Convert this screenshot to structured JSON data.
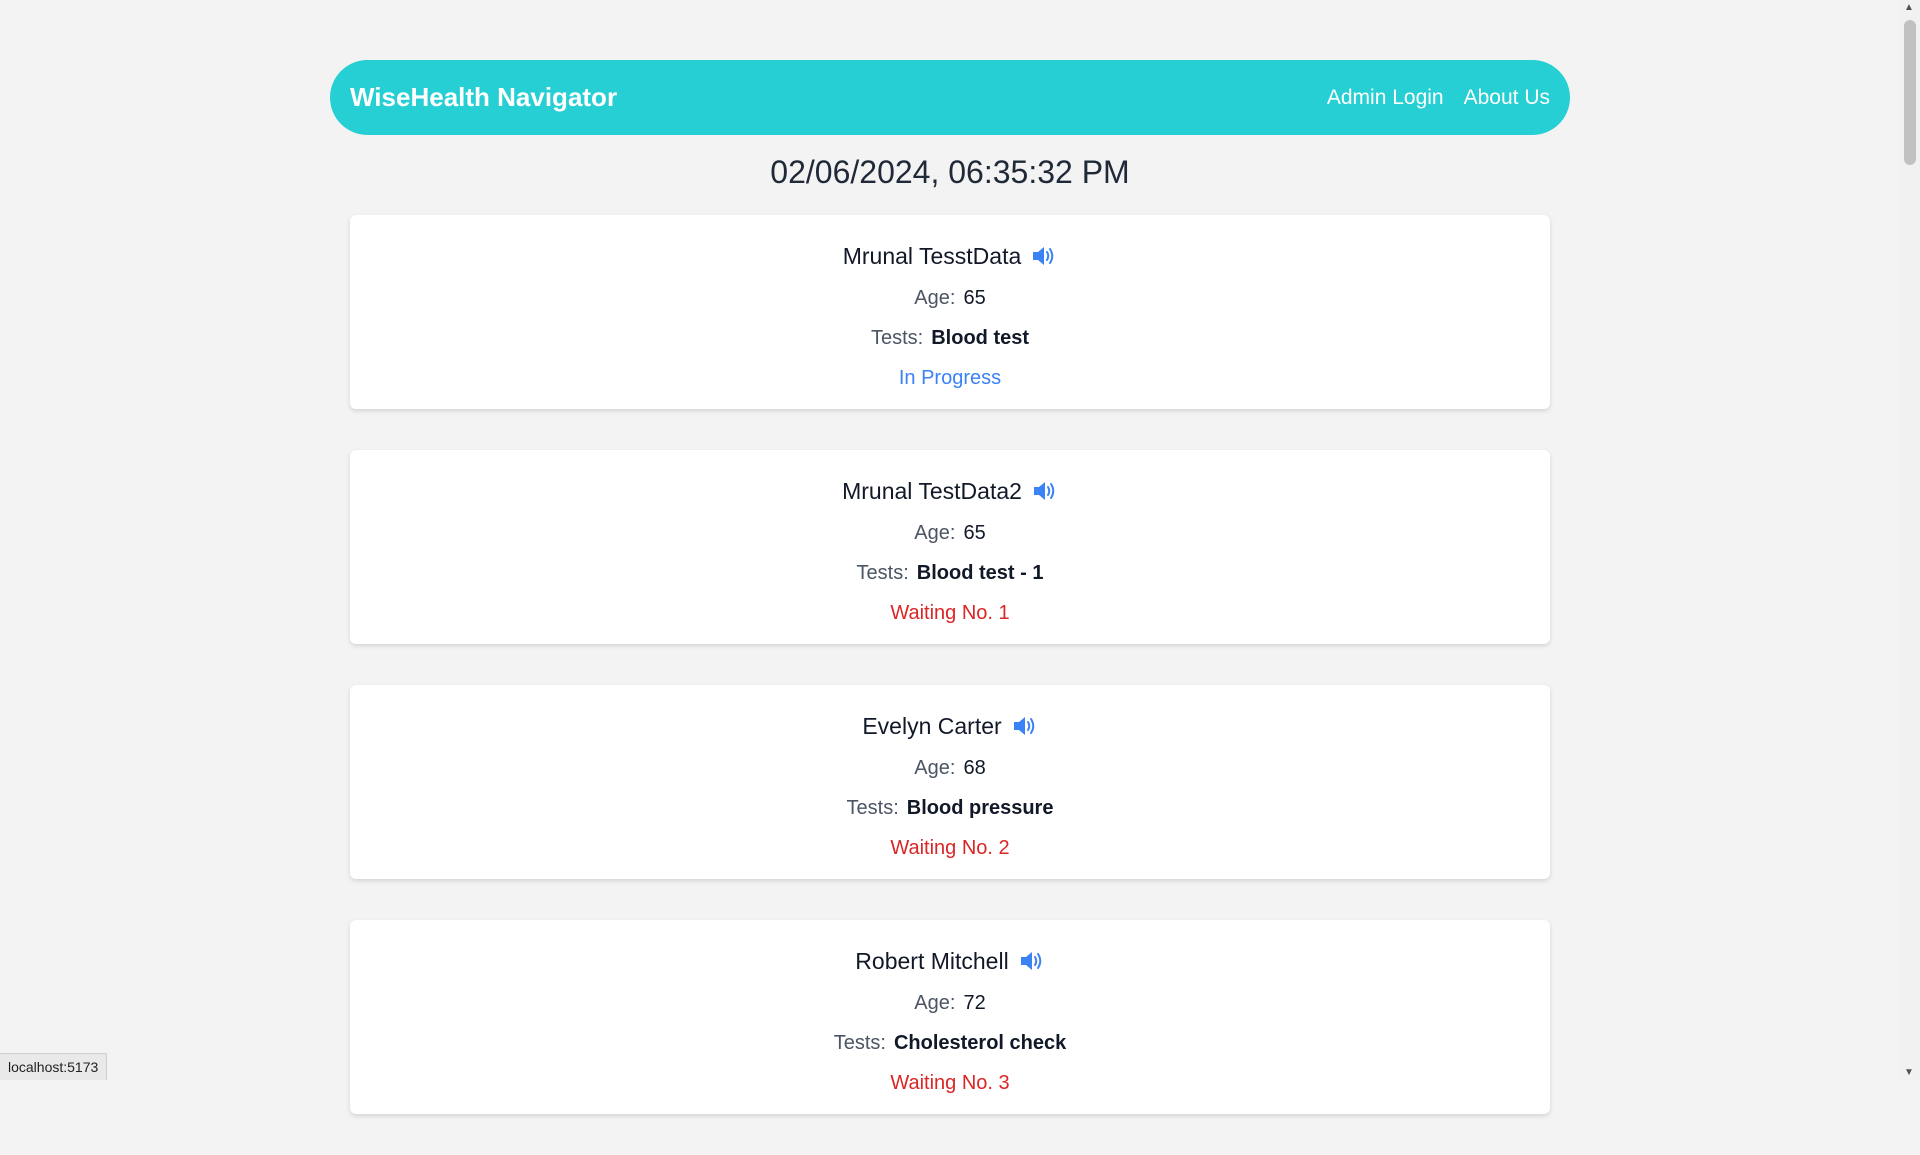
{
  "navbar": {
    "brand": "WiseHealth Navigator",
    "links": [
      "Admin Login",
      "About Us"
    ],
    "color": "#26cfd3"
  },
  "datetime": "02/06/2024, 06:35:32 PM",
  "labels": {
    "age": "Age:",
    "tests": "Tests:"
  },
  "patients": [
    {
      "name": "Mrunal TesstData",
      "age": "65",
      "tests": "Blood test",
      "status": "In Progress",
      "status_type": "progress"
    },
    {
      "name": "Mrunal TestData2",
      "age": "65",
      "tests": "Blood test - 1",
      "status": "Waiting No. 1",
      "status_type": "waiting"
    },
    {
      "name": "Evelyn Carter",
      "age": "68",
      "tests": "Blood pressure",
      "status": "Waiting No. 2",
      "status_type": "waiting"
    },
    {
      "name": "Robert Mitchell",
      "age": "72",
      "tests": "Cholesterol check",
      "status": "Waiting No. 3",
      "status_type": "waiting"
    }
  ],
  "icons": {
    "speaker": "speaker-icon",
    "scroll_up": "scroll-up-arrow-icon",
    "scroll_down": "scroll-down-arrow-icon"
  },
  "statusbar_url": "localhost:5173",
  "colors": {
    "in_progress": "#3b82f6",
    "waiting": "#dc2626",
    "background": "#f3f3f3"
  }
}
